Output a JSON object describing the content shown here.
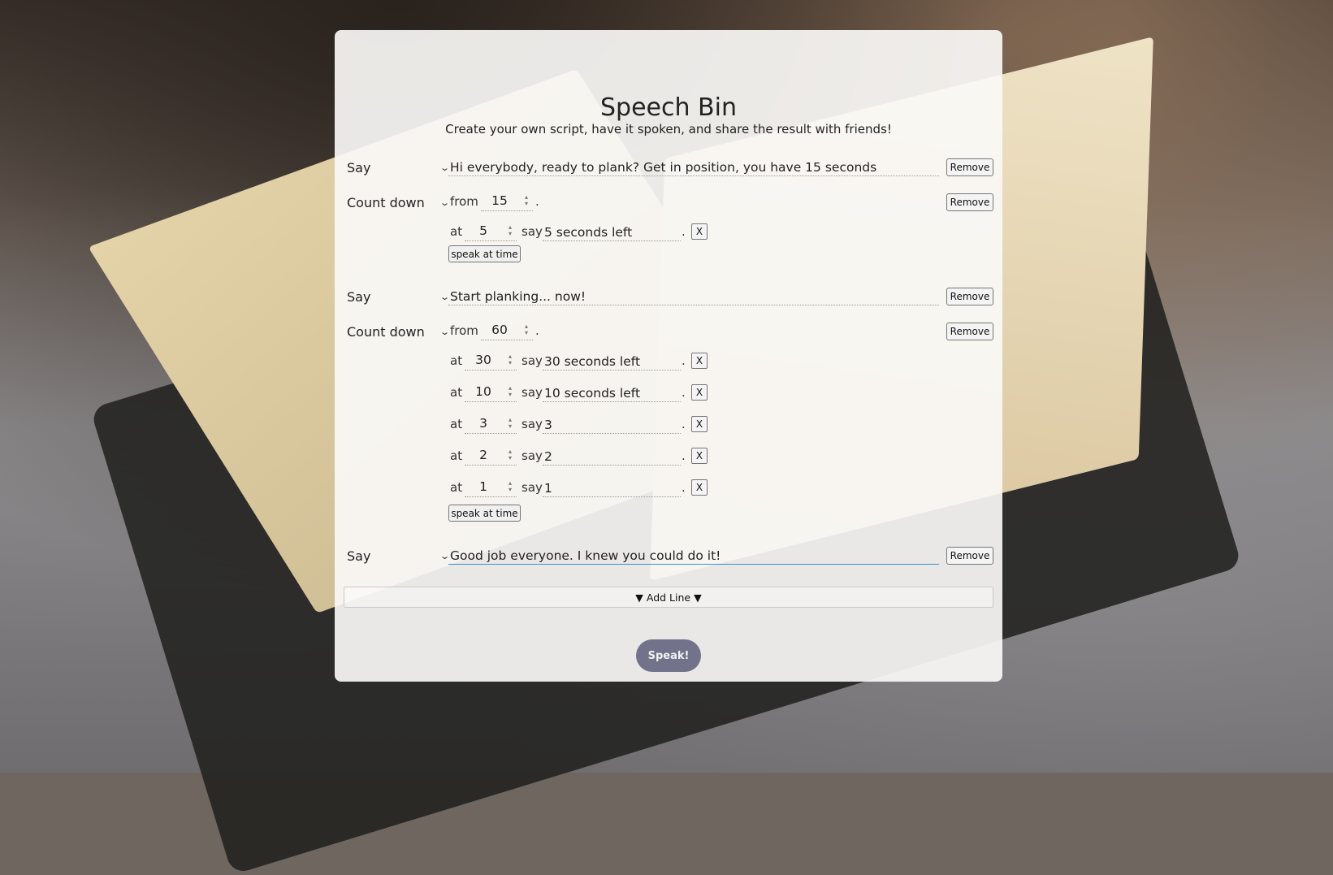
{
  "header": {
    "title": "Speech Bin",
    "subtitle": "Create your own script, have it spoken, and share the result with friends!"
  },
  "lines": [
    {
      "type": "Say",
      "text": "Hi everybody, ready to plank? Get in position, you have 15 seconds",
      "remove_label": "Remove"
    },
    {
      "type": "Count down",
      "from_label": "from",
      "from_value": "15",
      "remove_label": "Remove",
      "cues": [
        {
          "at_label": "at",
          "at": "5",
          "say_label": "say",
          "text": "5 seconds left",
          "x_label": "X"
        }
      ],
      "speak_at_time_label": "speak at time"
    },
    {
      "type": "Say",
      "text": "Start planking... now!",
      "remove_label": "Remove"
    },
    {
      "type": "Count down",
      "from_label": "from",
      "from_value": "60",
      "remove_label": "Remove",
      "cues": [
        {
          "at_label": "at",
          "at": "30",
          "say_label": "say",
          "text": "30 seconds left",
          "x_label": "X"
        },
        {
          "at_label": "at",
          "at": "10",
          "say_label": "say",
          "text": "10 seconds left",
          "x_label": "X"
        },
        {
          "at_label": "at",
          "at": "3",
          "say_label": "say",
          "text": "3",
          "x_label": "X"
        },
        {
          "at_label": "at",
          "at": "2",
          "say_label": "say",
          "text": "2",
          "x_label": "X"
        },
        {
          "at_label": "at",
          "at": "1",
          "say_label": "say",
          "text": "1",
          "x_label": "X"
        }
      ],
      "speak_at_time_label": "speak at time"
    },
    {
      "type": "Say",
      "text": "Good job everyone. I knew you could do it!",
      "remove_label": "Remove"
    }
  ],
  "add_line_label": "▼ Add Line ▼",
  "speak_label": "Speak!",
  "colors": {
    "speak_button": "#72728a",
    "focus_underline": "#3d8fd6"
  }
}
